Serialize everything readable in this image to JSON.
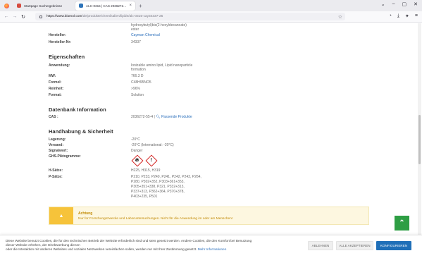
{
  "browser": {
    "tabs": [
      {
        "title": "Startpage Suchergebnisse",
        "active": false
      },
      {
        "title": "ALC-0315 | CAS 2036272-55-4 | ...",
        "active": true
      }
    ],
    "url_host": "https://www.biomol.com",
    "url_path": "/de/produkte/chemikalien/lipide/alc-0315-cay34337-25"
  },
  "product": {
    "name_tail_line1": "hydroxybutyl)bis(2-hexyldecanoate)",
    "name_tail_line2": "ester",
    "manufacturer_label": "Hersteller:",
    "manufacturer": "Cayman Chemical",
    "manufacturer_no_label": "Hersteller-Nr:",
    "manufacturer_no": "34337"
  },
  "properties": {
    "heading": "Eigenschaften",
    "application_label": "Anwendung:",
    "application_line1": "Ionizable amino lipid, Lipid nanoparticle",
    "application_line2": "formation",
    "mw_label": "MW:",
    "mw": "766.3 D",
    "formula_label": "Formel:",
    "formula": "C48H95NO5",
    "purity_label": "Reinheit:",
    "purity": ">96%",
    "format_label": "Format:",
    "format": "Solution"
  },
  "database": {
    "heading": "Datenbank Information",
    "cas_label": "CAS :",
    "cas": "2036272-55-4 |",
    "matching_products": "Passende Produkte"
  },
  "handling": {
    "heading": "Handhabung & Sicherheit",
    "storage_label": "Lagerung:",
    "storage": "-20°C",
    "shipping_label": "Versand:",
    "shipping": "-20°C (International: -20°C)",
    "signal_label": "Signalwort:",
    "signal": "Danger",
    "ghs_label": "GHS-Piktogramme:",
    "ghs_icons": [
      "flame-icon",
      "exclamation-icon"
    ],
    "h_label": "H-Sätze:",
    "h": "H225, H315, H319",
    "p_label": "P-Sätze:",
    "p_lines": [
      "P210, P233, P240, P241, P242, P243, P264,",
      "P280, P302+352, P303+361+353,",
      "P305+351+338, P321, P332+313,",
      "P337+313, P362+364, P370+378,",
      "P403+235, P501"
    ]
  },
  "warning": {
    "title": "Achtung",
    "message": "Nur für Forschungszwecke und Laboruntersuchungen. Nicht für die Anwendung im oder am Menschen!"
  },
  "cookie": {
    "line1": "Diese Website benutzt Cookies, die für den technischen Betrieb der Website erforderlich sind und stets gesetzt werden. Andere Cookies, die den Komfort bei Benutzung",
    "line2": "dieser Website erhöhen, der Direktwerbung dienen",
    "line3": "oder die Interaktion mit anderen Websites und sozialen Netzwerken vereinfachen sollen, werden nur mit Ihrer Zustimmung gesetzt.",
    "more_info": "Mehr Informationen",
    "decline": "ABLEHNEN",
    "accept_all": "ALLE AKZEPTIEREN",
    "configure": "KONFIGURIEREN"
  },
  "colors": {
    "accent_blue": "#1f6fb8",
    "link_blue": "#2a6ebb",
    "warning_yellow": "#f6c33a",
    "green": "#2e9e44"
  }
}
